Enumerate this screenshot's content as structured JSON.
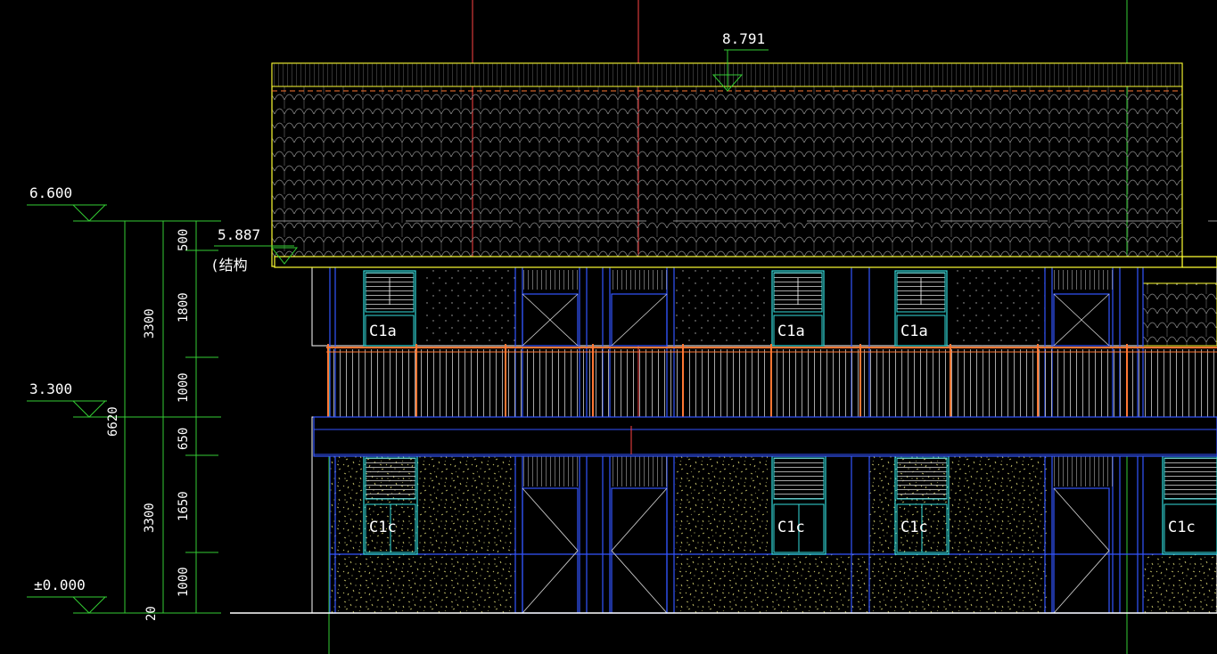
{
  "elevations": {
    "ridge": "8.791",
    "roof_top": "6.600",
    "eave": "5.887",
    "eave_note": "(结构",
    "floor2": "3.300",
    "ground": "±0.000"
  },
  "dimensions": {
    "total": "6620",
    "upper_storey": "3300",
    "lower_storey": "3300",
    "seg_500": "500",
    "seg_1800": "1800",
    "seg_1000_upper": "1000",
    "seg_650": "650",
    "seg_1650": "1650",
    "seg_1000_lower": "1000",
    "seg_20": "20"
  },
  "windows": {
    "upper": "C1a",
    "lower": "C1c"
  },
  "colors": {
    "background": "#000000",
    "roof_outline": "#ffff33",
    "dimension": "#33cc33",
    "wall": "#3355ff",
    "window": "#33dddd",
    "railing": "#ff7733",
    "axis": "#ff4444",
    "text": "#ffffff"
  }
}
